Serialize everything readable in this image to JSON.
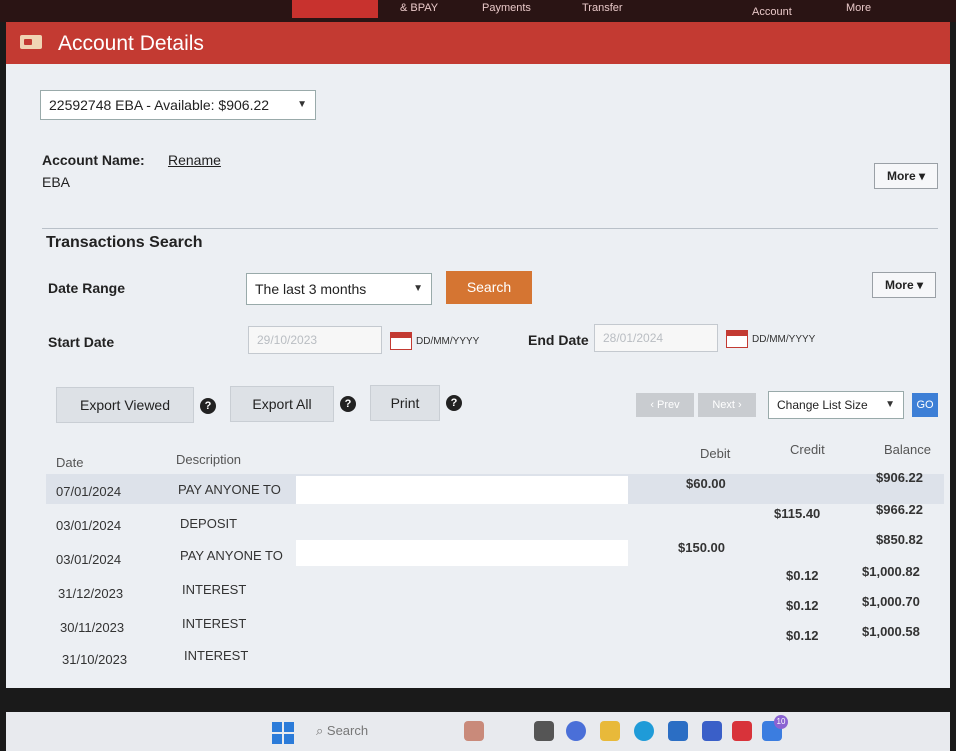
{
  "topnav": {
    "items": [
      {
        "label": "& BPAY"
      },
      {
        "label": "Payments"
      },
      {
        "label": "Transfer"
      },
      {
        "label": "Account"
      },
      {
        "label": "More"
      }
    ]
  },
  "header": {
    "title": "Account Details",
    "icon": "account-card-icon"
  },
  "account": {
    "selected": "22592748 EBA - Available: $906.22",
    "name_label": "Account Name:",
    "rename_label": "Rename",
    "name_value": "EBA",
    "more_label": "More"
  },
  "search": {
    "heading": "Transactions Search",
    "date_range_label": "Date Range",
    "date_range_value": "The last 3 months",
    "search_button": "Search",
    "more_label": "More",
    "start_date_label": "Start Date",
    "start_date_value": "29/10/2023",
    "start_date_format": "DD/MM/YYYY",
    "end_date_label": "End Date",
    "end_date_value": "28/01/2024",
    "end_date_format": "DD/MM/YYYY"
  },
  "toolbar": {
    "export_viewed": "Export Viewed",
    "export_all": "Export All",
    "print": "Print",
    "help_glyph": "?",
    "prev": "‹ Prev",
    "next": "Next ›",
    "list_size": "Change List Size",
    "go": "GO"
  },
  "table": {
    "headers": {
      "date": "Date",
      "description": "Description",
      "debit": "Debit",
      "credit": "Credit",
      "balance": "Balance"
    },
    "rows": [
      {
        "date": "07/01/2024",
        "description": "PAY ANYONE TO",
        "debit": "$60.00",
        "credit": "",
        "balance": "$906.22"
      },
      {
        "date": "03/01/2024",
        "description": "DEPOSIT",
        "debit": "",
        "credit": "$115.40",
        "balance": "$966.22"
      },
      {
        "date": "03/01/2024",
        "description": "PAY ANYONE TO",
        "debit": "$150.00",
        "credit": "",
        "balance": "$850.82"
      },
      {
        "date": "31/12/2023",
        "description": "INTEREST",
        "debit": "",
        "credit": "$0.12",
        "balance": "$1,000.82"
      },
      {
        "date": "30/11/2023",
        "description": "INTEREST",
        "debit": "",
        "credit": "$0.12",
        "balance": "$1,000.70"
      },
      {
        "date": "31/10/2023",
        "description": "INTEREST",
        "debit": "",
        "credit": "$0.12",
        "balance": "$1,000.58"
      }
    ]
  },
  "taskbar": {
    "search_placeholder": "Search",
    "badge": "10"
  },
  "colors": {
    "brand_red": "#c33a32",
    "search_orange": "#d57532",
    "go_blue": "#3d7fd6"
  }
}
